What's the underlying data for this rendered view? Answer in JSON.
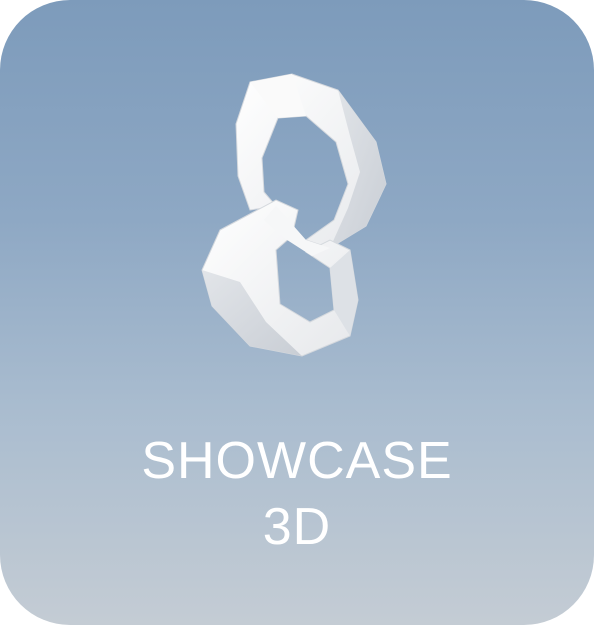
{
  "app": {
    "title_line1": "SHOWCASE",
    "title_line2": "3D",
    "icon_name": "chain-links-icon"
  },
  "colors": {
    "gradient_top": "#7d9bbb",
    "gradient_bottom": "#c4ccd4",
    "text": "#ffffff",
    "link_face": "#f4f4f4",
    "link_shade": "#d7dadf"
  }
}
